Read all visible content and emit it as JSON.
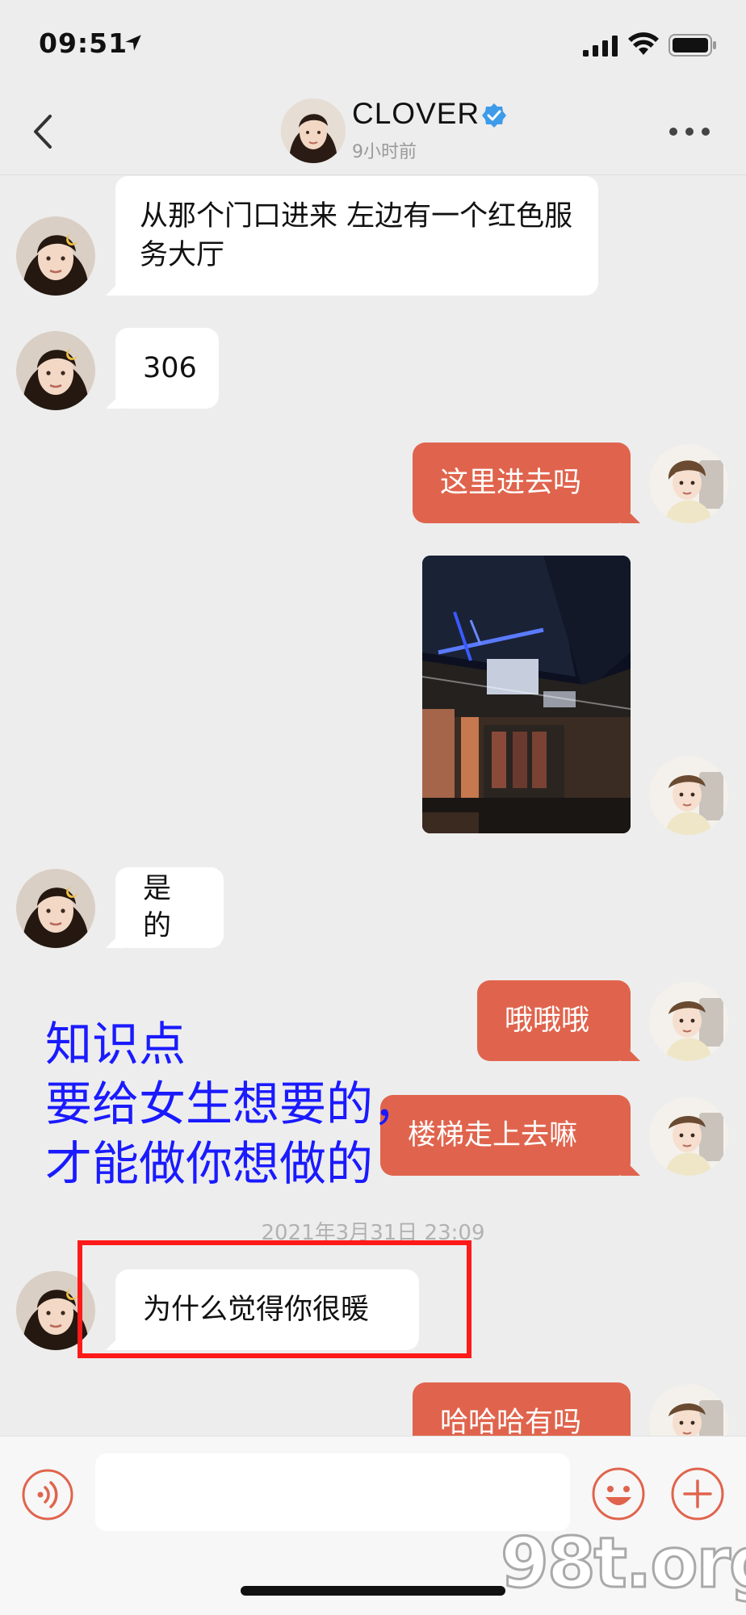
{
  "status_bar": {
    "time": "09:51"
  },
  "header": {
    "name": "CLOVER",
    "subtitle": "9小时前",
    "verified": true
  },
  "messages": [
    {
      "side": "in",
      "text": "从那个门口进来  左边有一个红色服务大厅"
    },
    {
      "side": "in",
      "text": "306"
    },
    {
      "side": "out",
      "text": "这里进去吗"
    },
    {
      "side": "out",
      "type": "image"
    },
    {
      "side": "in",
      "text": "是的"
    },
    {
      "side": "out",
      "text": "哦哦哦"
    },
    {
      "side": "out",
      "text": "楼梯走上去嘛"
    },
    {
      "side": "in",
      "text": "为什么觉得你很暖"
    },
    {
      "side": "out",
      "text": "哈哈哈有吗"
    }
  ],
  "timestamp": "2021年3月31日 23:09",
  "overlay_note": "知识点\n要给女生想要的，\n才能做你想做的",
  "input": {
    "value": "",
    "placeholder": ""
  },
  "watermark": "98t.org",
  "colors": {
    "background": "#ededed",
    "outgoing_bubble": "#e0644d",
    "incoming_bubble": "#ffffff",
    "accent_icon": "#e0644d",
    "verified_badge": "#3d9be9",
    "highlight_box": "#ff1a1a",
    "overlay_text": "#1a1aff"
  },
  "icons": {
    "back": "chevron-left-icon",
    "more": "more-dots-icon",
    "voice": "voice-icon",
    "emoji": "emoji-icon",
    "plus": "plus-icon"
  }
}
